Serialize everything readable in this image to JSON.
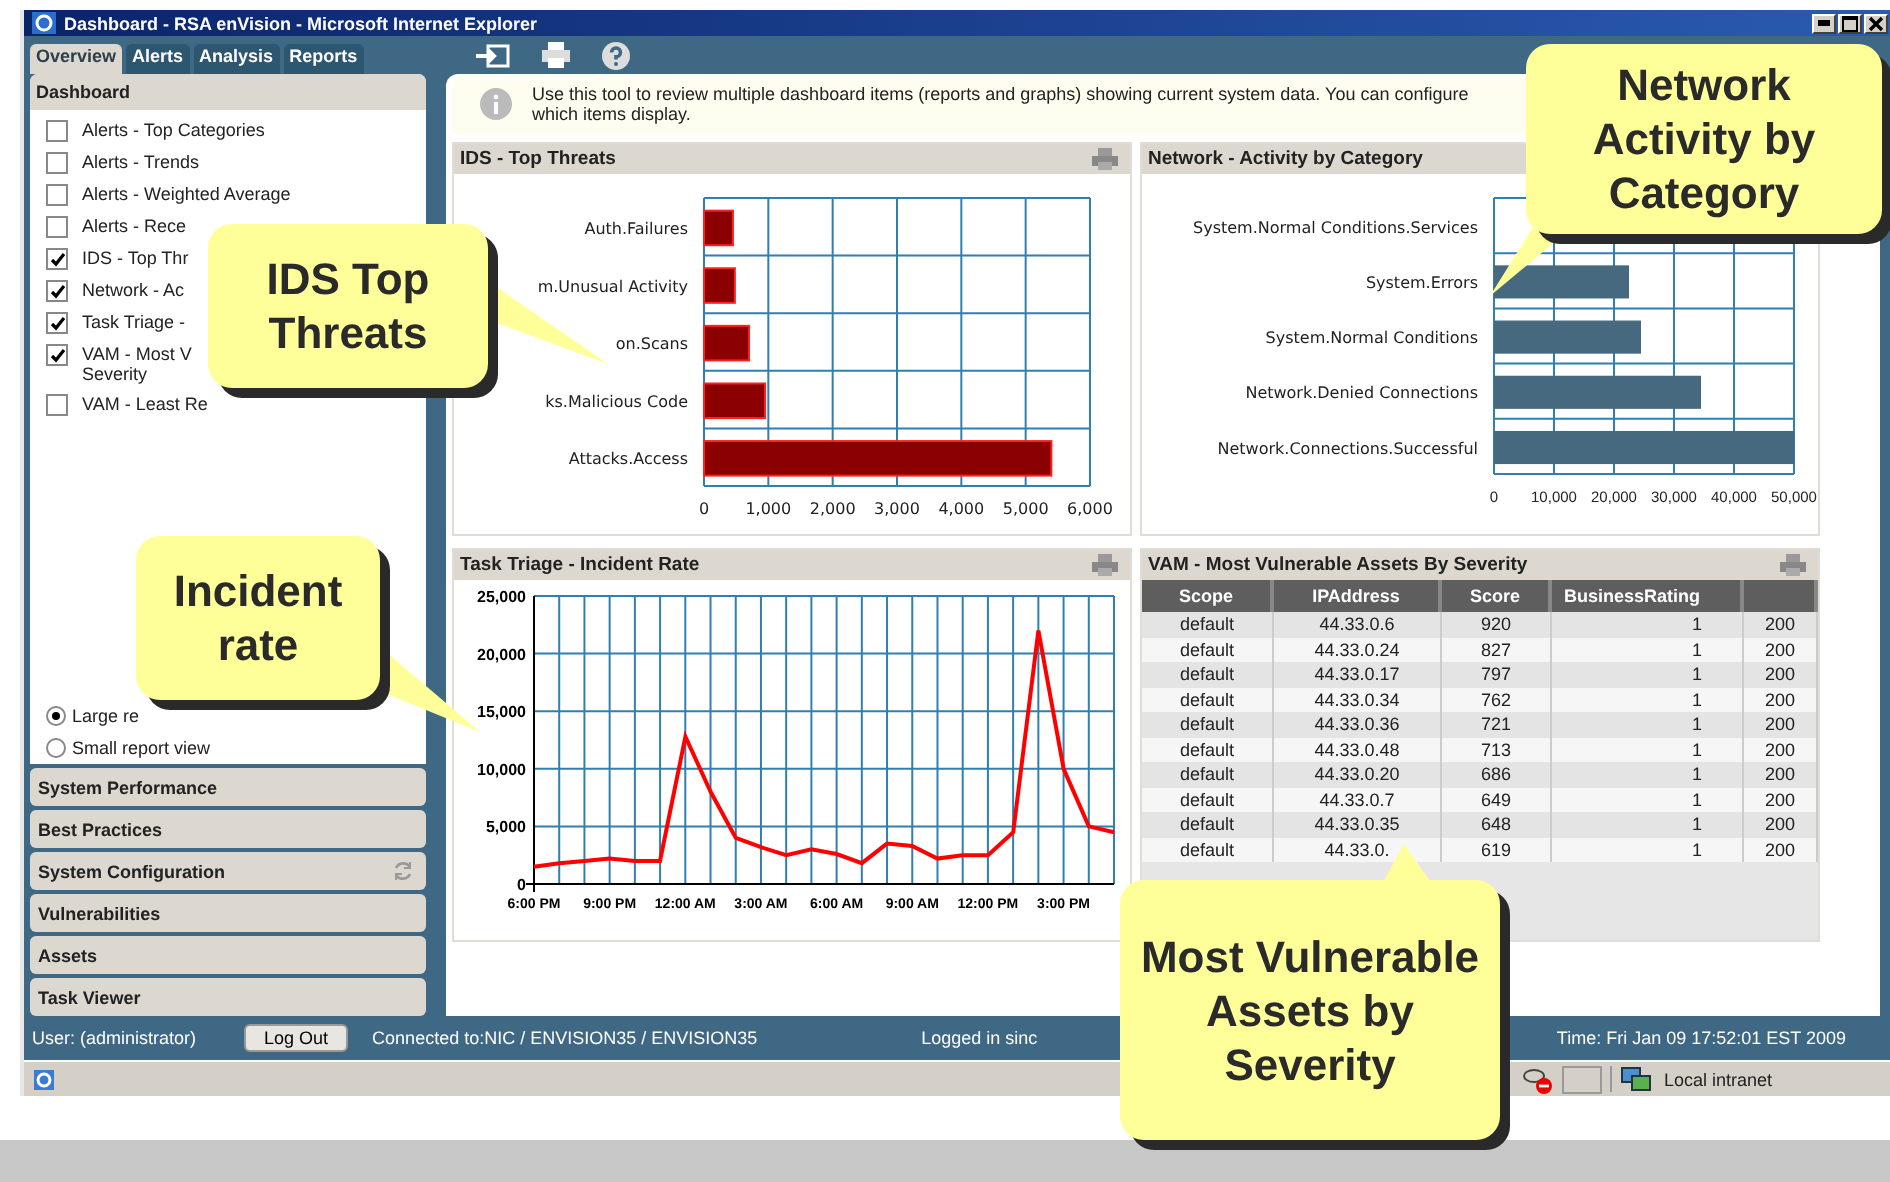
{
  "window": {
    "title": "Dashboard - RSA enVision - Microsoft Internet Explorer"
  },
  "tabs": [
    {
      "label": "Overview",
      "selected": true
    },
    {
      "label": "Alerts",
      "selected": false
    },
    {
      "label": "Analysis",
      "selected": false
    },
    {
      "label": "Reports",
      "selected": false
    }
  ],
  "sidebar": {
    "section": "Dashboard",
    "items": [
      {
        "label": "Alerts - Top Categories",
        "checked": false
      },
      {
        "label": "Alerts - Trends",
        "checked": false
      },
      {
        "label": "Alerts - Weighted Average",
        "checked": false
      },
      {
        "label": "Alerts - Rece",
        "checked": false
      },
      {
        "label": "IDS - Top Thr",
        "checked": true
      },
      {
        "label": "Network - Ac",
        "checked": true
      },
      {
        "label": "Task Triage -",
        "checked": true
      },
      {
        "label": "VAM - Most V",
        "label_2": "Severity",
        "checked": true
      },
      {
        "label": "VAM - Least Re",
        "checked": false
      }
    ],
    "views": [
      {
        "label": "Large re",
        "selected": true
      },
      {
        "label": "Small report view",
        "selected": false
      }
    ],
    "sections": [
      {
        "label": "System Performance",
        "busy": false
      },
      {
        "label": "Best Practices",
        "busy": false
      },
      {
        "label": "System Configuration",
        "busy": true
      },
      {
        "label": "Vulnerabilities",
        "busy": false
      },
      {
        "label": "Assets",
        "busy": false
      },
      {
        "label": "Task Viewer",
        "busy": false
      }
    ]
  },
  "info": "Use this tool to review multiple dashboard items (reports and graphs) showing current system data. You can configure which items display.",
  "panels": [
    {
      "title": "IDS - Top Threats",
      "kind": "chart",
      "print_icon": true,
      "chart_data": {
        "type": "bar",
        "orientation": "horizontal",
        "categories": [
          "Auth.Failures",
          "m.Unusual Activity",
          "on.Scans",
          "ks.Malicious Code",
          "Attacks.Access"
        ],
        "series": [
          {
            "color": "#8b0000",
            "values": [
              450,
              480,
              700,
              950,
              5400
            ]
          }
        ],
        "grid": true,
        "xlim": [
          0,
          6000
        ],
        "xticks": [
          {
            "value": 0,
            "label": "0"
          },
          {
            "value": 1000,
            "label": "1,000"
          },
          {
            "value": 2000,
            "label": "2,000"
          },
          {
            "value": 3000,
            "label": "3,000"
          },
          {
            "value": 4000,
            "label": "4,000"
          },
          {
            "value": 5000,
            "label": "5,000"
          },
          {
            "value": 6000,
            "label": "6,000"
          }
        ]
      }
    },
    {
      "title": "Network - Activity by Category",
      "kind": "chart",
      "print_icon": false,
      "chart_data": {
        "type": "bar",
        "orientation": "horizontal",
        "categories": [
          "System.Normal Conditions.Services",
          "System.Errors",
          "System.Normal Conditions",
          "Network.Denied Connections",
          "Network.Connections.Successful"
        ],
        "series": [
          {
            "color": "#46697f",
            "values": [
              null,
              22500,
              24500,
              34500,
              50000
            ]
          }
        ],
        "grid": true,
        "xlim": [
          0,
          50000
        ],
        "xticks": [
          {
            "value": 0,
            "label": "0"
          },
          {
            "value": 10000,
            "label": "10,000"
          },
          {
            "value": 20000,
            "label": "20,000"
          },
          {
            "value": 30000,
            "label": "30,000"
          },
          {
            "value": 40000,
            "label": "40,000"
          },
          {
            "value": 50000,
            "label": "50,000"
          }
        ]
      }
    },
    {
      "title": "Task Triage - Incident Rate",
      "kind": "chart",
      "print_icon": true,
      "chart_data": {
        "type": "line",
        "categories": [
          "6:00 PM",
          null,
          null,
          "9:00 PM",
          null,
          null,
          "12:00 AM",
          null,
          null,
          "3:00 AM",
          null,
          null,
          "6:00 AM",
          null,
          null,
          "9:00 AM",
          null,
          null,
          "12:00 PM",
          null,
          null,
          "3:00 PM",
          null,
          null
        ],
        "series": [
          {
            "color": "#ff0000",
            "values": [
              1500,
              1800,
              2000,
              2200,
              2000,
              2000,
              12800,
              8000,
              4000,
              3200,
              2500,
              3000,
              2600,
              1800,
              3500,
              3300,
              2200,
              2500,
              2500,
              4500,
              22000,
              10000,
              5000,
              4500
            ]
          }
        ],
        "grid": true,
        "ylim": [
          0,
          25000
        ],
        "yticks": [
          {
            "value": 0,
            "label": "0"
          },
          {
            "value": 5000,
            "label": "5,000"
          },
          {
            "value": 10000,
            "label": "10,000"
          },
          {
            "value": 15000,
            "label": "15,000"
          },
          {
            "value": 20000,
            "label": "20,000"
          },
          {
            "value": 25000,
            "label": "25,000"
          }
        ]
      }
    },
    {
      "title": "VAM - Most Vulnerable Assets By Severity",
      "kind": "table",
      "print_icon": true,
      "table": {
        "columns": [
          "Scope",
          "IPAddress",
          "Score",
          "BusinessRating"
        ],
        "rows": [
          [
            "default",
            "44.33.0.6",
            "920",
            "1",
            "200"
          ],
          [
            "default",
            "44.33.0.24",
            "827",
            "1",
            "200"
          ],
          [
            "default",
            "44.33.0.17",
            "797",
            "1",
            "200"
          ],
          [
            "default",
            "44.33.0.34",
            "762",
            "1",
            "200"
          ],
          [
            "default",
            "44.33.0.36",
            "721",
            "1",
            "200"
          ],
          [
            "default",
            "44.33.0.48",
            "713",
            "1",
            "200"
          ],
          [
            "default",
            "44.33.0.20",
            "686",
            "1",
            "200"
          ],
          [
            "default",
            "44.33.0.7",
            "649",
            "1",
            "200"
          ],
          [
            "default",
            "44.33.0.35",
            "648",
            "1",
            "200"
          ],
          [
            "default",
            "44.33.0.",
            "619",
            "1",
            "200"
          ]
        ]
      }
    }
  ],
  "status": {
    "user": "User: (administrator)",
    "logout": "Log Out",
    "connected": "Connected to:NIC / ENVISION35 / ENVISION35",
    "logged": "Logged in sinc",
    "time": "Time: Fri Jan 09 17:52:01 EST 2009"
  },
  "ie_status": {
    "zone": "Local intranet"
  },
  "callouts": [
    "IDS Top Threats",
    "Network Activity by Category",
    "Incident rate",
    "Most Vulnerable Assets by Severity"
  ]
}
